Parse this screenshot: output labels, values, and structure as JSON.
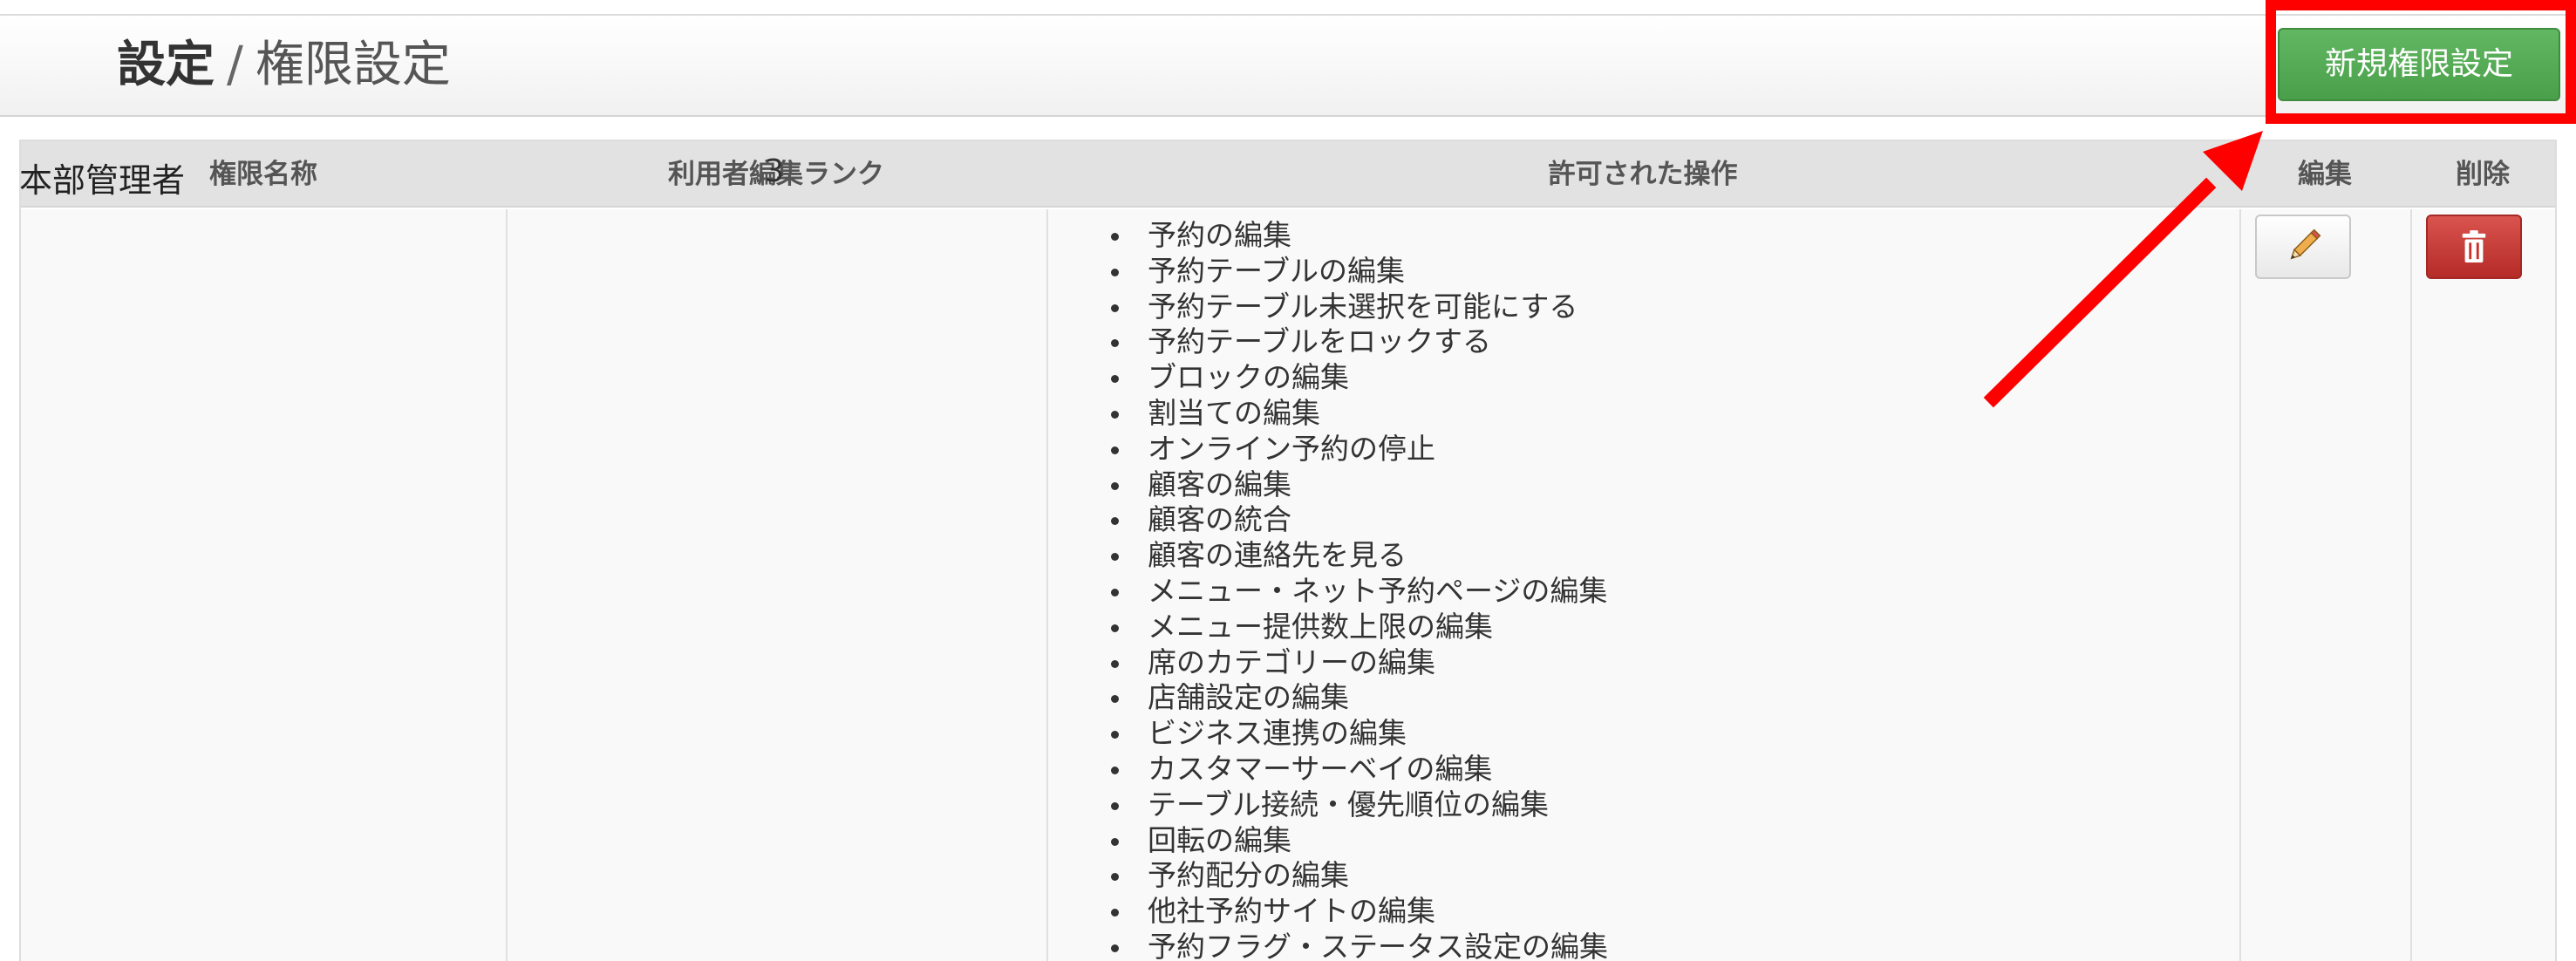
{
  "header": {
    "title_current": "設定",
    "separator": "/",
    "title_sub": "権限設定",
    "new_button_label": "新規権限設定"
  },
  "table": {
    "columns": {
      "name": "権限名称",
      "rank": "利用者編集ランク",
      "ops": "許可された操作",
      "edit": "編集",
      "delete": "削除"
    },
    "rows": [
      {
        "name": "本部管理者",
        "rank": "3",
        "operations": [
          "予約の編集",
          "予約テーブルの編集",
          "予約テーブル未選択を可能にする",
          "予約テーブルをロックする",
          "ブロックの編集",
          "割当ての編集",
          "オンライン予約の停止",
          "顧客の編集",
          "顧客の統合",
          "顧客の連絡先を見る",
          "メニュー・ネット予約ページの編集",
          "メニュー提供数上限の編集",
          "席のカテゴリーの編集",
          "店舗設定の編集",
          "ビジネス連携の編集",
          "カスタマーサーベイの編集",
          "テーブル接続・優先順位の編集",
          "回転の編集",
          "予約配分の編集",
          "他社予約サイトの編集",
          "予約フラグ・ステータス設定の編集"
        ]
      }
    ]
  },
  "icons": {
    "edit": "pencil-icon",
    "delete": "trash-icon"
  },
  "colors": {
    "new_button": "#4a9f4a",
    "delete_button": "#c9302c",
    "highlight": "#ff0000",
    "arrow": "#ff0000"
  }
}
